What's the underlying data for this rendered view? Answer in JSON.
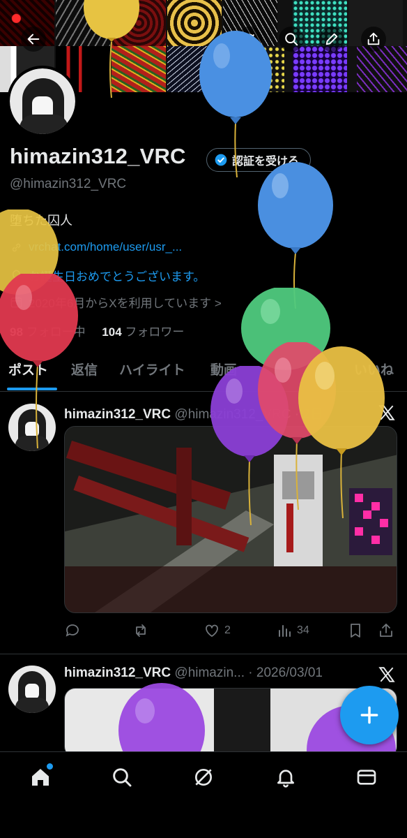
{
  "profile": {
    "display_name": "himazin312_VRC",
    "verify_label": "認証を受ける",
    "handle": "@himazin312_VRC",
    "bio": "堕ちた囚人",
    "link": "vrchat.com/home/user/usr_...",
    "birthday": "お誕生日おめでとうございます。",
    "joined": "2020年6月からXを利用しています >",
    "following_count": "98",
    "following_label": " フォロー中",
    "followers_count": "104",
    "followers_label": " フォロワー"
  },
  "tabs": [
    {
      "label": "ポスト"
    },
    {
      "label": "返信"
    },
    {
      "label": "ハイライト"
    },
    {
      "label": "動画"
    },
    {
      "label": "いいね"
    }
  ],
  "posts": [
    {
      "name": "himazin312_VRC",
      "sub": " @himazin312_VRC · 2日",
      "replies": "",
      "reposts": "",
      "likes": "2",
      "views": "34"
    },
    {
      "name": "himazin312_VRC",
      "sub": " @himazin... · 2026/03/01"
    }
  ],
  "icons": {
    "back": "arrow-left-icon",
    "search": "search-icon",
    "edit": "pencil-icon",
    "share": "share-icon",
    "verified": "verified-badge-icon"
  },
  "colors": {
    "accent": "#1d9bf0",
    "background": "#000000",
    "muted_text": "#71767b"
  }
}
